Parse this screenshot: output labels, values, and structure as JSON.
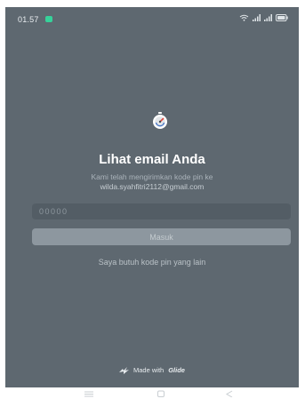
{
  "status_bar": {
    "time": "01.57",
    "indicator_color": "#36d29a",
    "icons": [
      "wifi-icon",
      "signal-icon",
      "signal-icon",
      "battery-icon"
    ]
  },
  "login": {
    "logo_icon": "glide-app-logo-icon",
    "title": "Lihat email Anda",
    "subtitle_line1": "Kami telah mengirimkan kode pin ke",
    "email": "wilda.syahfitri2112@gmail.com",
    "pin_placeholder": "00000",
    "pin_value": "",
    "submit_label": "Masuk",
    "resend_label": "Saya butuh kode pin yang lain"
  },
  "footer": {
    "made_with": "Made with",
    "brand": "Glide",
    "brand_icon": "glide-bolt-icon"
  },
  "navigation_bar": {
    "buttons": [
      "recent-apps-icon",
      "home-icon",
      "back-icon"
    ]
  },
  "colors": {
    "background": "#5e6870",
    "input_bg": "#535d65",
    "button_bg": "#8d979f",
    "text_primary": "#ffffff",
    "text_muted": "#aab3ba"
  }
}
